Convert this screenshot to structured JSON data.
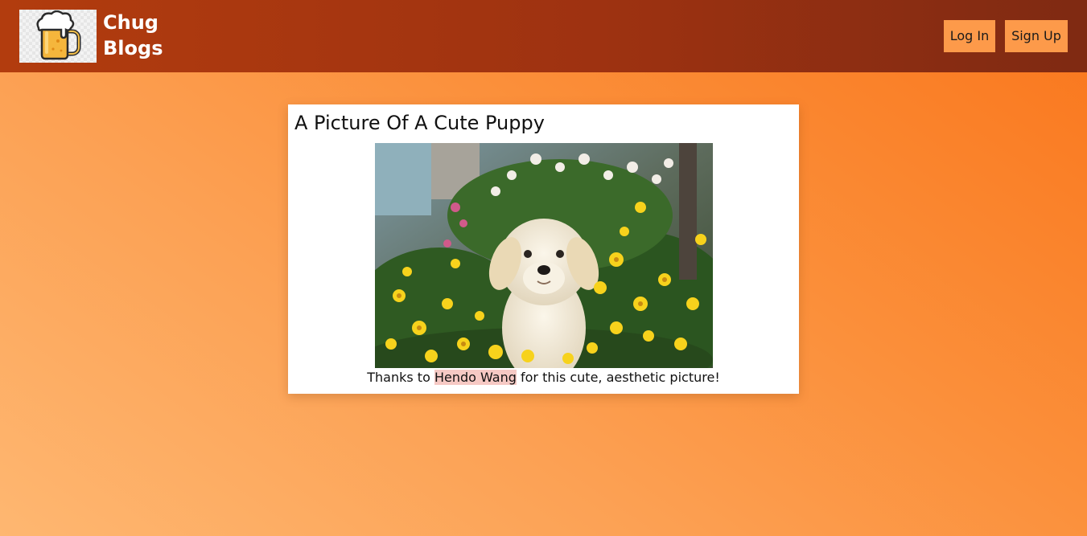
{
  "header": {
    "brand_line1": "Chug",
    "brand_line2": "Blogs",
    "logo_icon": "beer-mug-icon",
    "colors": {
      "bar_start": "#b23c0e",
      "bar_end": "#7f2a12",
      "button_bg": "#fd9a4a"
    }
  },
  "nav": {
    "login_label": "Log In",
    "signup_label": "Sign Up"
  },
  "post": {
    "title": "A Picture Of A Cute Puppy",
    "image_icon": "puppy-in-flowers-photo",
    "caption_before": "Thanks to ",
    "author_name": "Hendo Wang",
    "caption_after": " for this cute, aesthetic picture!"
  },
  "page": {
    "background_colors": [
      "#feb771",
      "#f9761c"
    ]
  }
}
